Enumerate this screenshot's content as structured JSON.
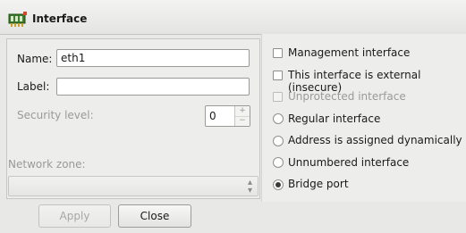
{
  "window": {
    "title": "Interface",
    "icon": "network-interface-icon"
  },
  "form": {
    "name_label": "Name:",
    "name_value": "eth1",
    "label_label": "Label:",
    "label_value": "",
    "security_label": "Security level:",
    "security_value": "0",
    "zone_label": "Network zone:",
    "zone_value": ""
  },
  "options": {
    "checkboxes": [
      {
        "label": "Management interface",
        "checked": false,
        "enabled": true
      },
      {
        "label": "This interface is external (insecure)",
        "checked": false,
        "enabled": true
      },
      {
        "label": "Unprotected interface",
        "checked": false,
        "enabled": false
      }
    ],
    "radios": [
      {
        "label": "Regular interface",
        "selected": false
      },
      {
        "label": "Address is assigned dynamically",
        "selected": false
      },
      {
        "label": "Unnumbered interface",
        "selected": false
      },
      {
        "label": "Bridge port",
        "selected": true
      }
    ]
  },
  "buttons": {
    "apply": "Apply",
    "close": "Close"
  }
}
